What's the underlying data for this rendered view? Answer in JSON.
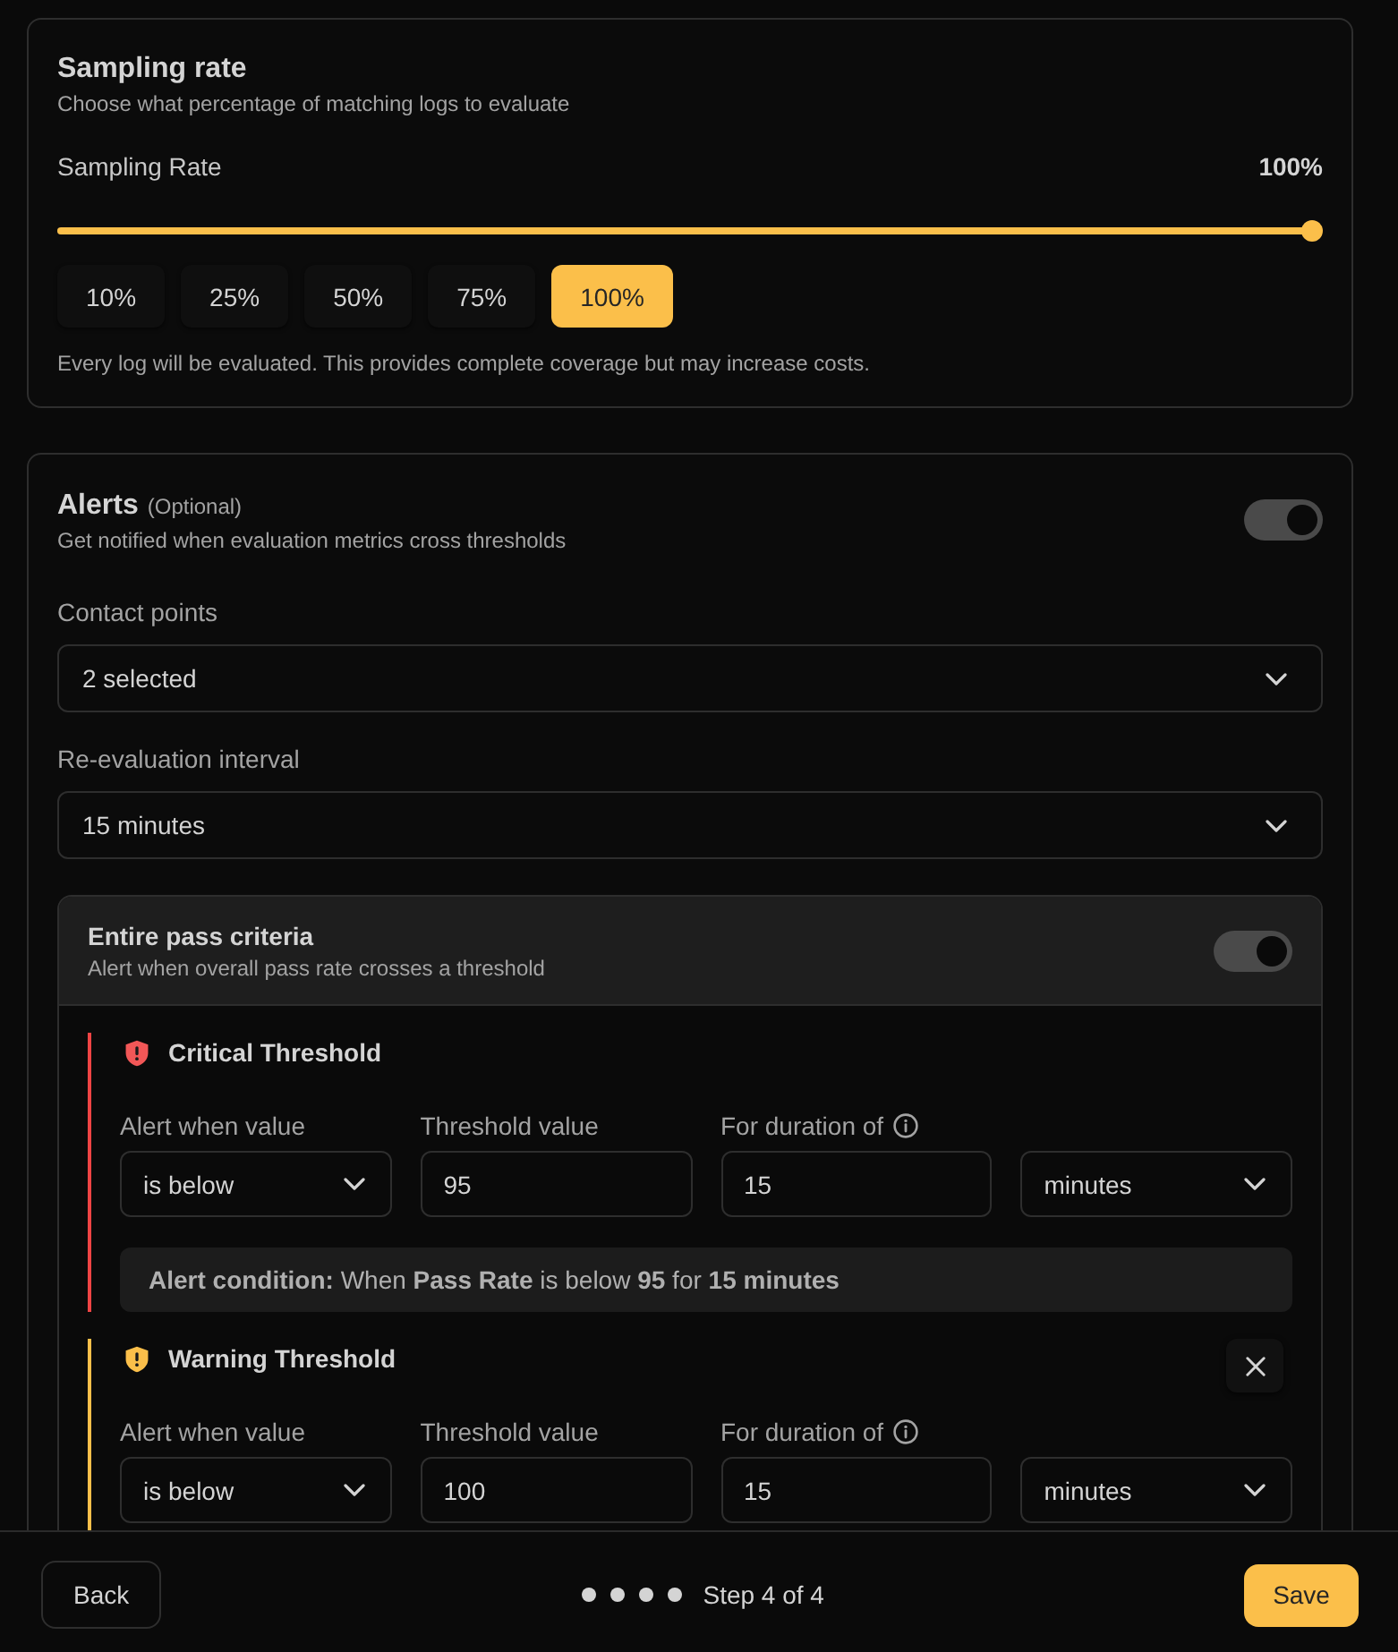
{
  "sampling_rate": {
    "title": "Sampling rate",
    "subtitle": "Choose what percentage of matching logs to evaluate",
    "label": "Sampling Rate",
    "reading": "100%",
    "level": 1,
    "presets": [
      {
        "label": "10%",
        "selected": false
      },
      {
        "label": "25%",
        "selected": false
      },
      {
        "label": "50%",
        "selected": false
      },
      {
        "label": "75%",
        "selected": false
      },
      {
        "label": "100%",
        "selected": true
      }
    ],
    "note": "Every log will be evaluated. This provides complete coverage but may increase costs."
  },
  "alerts": {
    "title": "Alerts",
    "tag": "(Optional)",
    "subtitle": "Get notified when evaluation metrics cross thresholds",
    "on": true,
    "fields": [
      {
        "label": "Contact points",
        "value": "2 selected"
      },
      {
        "label": "Re-evaluation interval",
        "value": "15 minutes"
      }
    ],
    "pass_criteria": {
      "title": "Entire pass criteria",
      "subtitle": "Alert when overall pass rate crosses a threshold",
      "on": true,
      "thresholds": [
        {
          "kind": "critical",
          "title": "Critical Threshold",
          "removable": false,
          "fields": [
            {
              "kind": "select",
              "label": "Alert when value",
              "info": false,
              "value": "is below"
            },
            {
              "kind": "input",
              "label": "Threshold value",
              "info": false,
              "value": "95"
            },
            {
              "kind": "input",
              "label": "For duration of",
              "info": true,
              "value": "15"
            },
            {
              "kind": "select",
              "info": false,
              "value": "minutes"
            }
          ],
          "condition": "**Alert condition:** When **Pass Rate** is below **95** for **15 minutes**"
        },
        {
          "kind": "warning",
          "title": "Warning Threshold",
          "removable": true,
          "fields": [
            {
              "kind": "select",
              "label": "Alert when value",
              "info": false,
              "value": "is below"
            },
            {
              "kind": "input",
              "label": "Threshold value",
              "info": false,
              "value": "100"
            },
            {
              "kind": "input",
              "label": "For duration of",
              "info": true,
              "value": "15"
            },
            {
              "kind": "select",
              "info": false,
              "value": "minutes"
            }
          ]
        }
      ]
    }
  },
  "footer": {
    "back": "Back",
    "steps": [
      {
        "completed": true
      },
      {
        "completed": true
      },
      {
        "completed": true
      },
      {
        "completed": true
      }
    ],
    "step_label": "Step 4 of 4",
    "save": "Save"
  }
}
